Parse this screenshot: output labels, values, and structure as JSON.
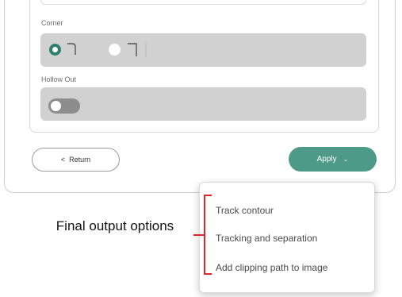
{
  "panel": {
    "corner_label": "Corner",
    "corner_options": [
      {
        "name": "rounded-corner",
        "selected": true
      },
      {
        "name": "square-corner",
        "selected": false
      }
    ],
    "hollow_out_label": "Hollow Out",
    "hollow_out_enabled": false
  },
  "buttons": {
    "return_label": "Return",
    "return_icon": "<",
    "apply_label": "Apply",
    "apply_icon": "chevron-down-icon"
  },
  "apply_menu": {
    "items": [
      "Track contour",
      "Tracking and separation",
      "Add clipping path to image"
    ]
  },
  "annotation": {
    "text": "Final output options",
    "color": "#e0252c"
  },
  "colors": {
    "accent": "#4d9a88",
    "radio_selected": "#2f7f6f",
    "field_bg": "#d1d1d1"
  }
}
